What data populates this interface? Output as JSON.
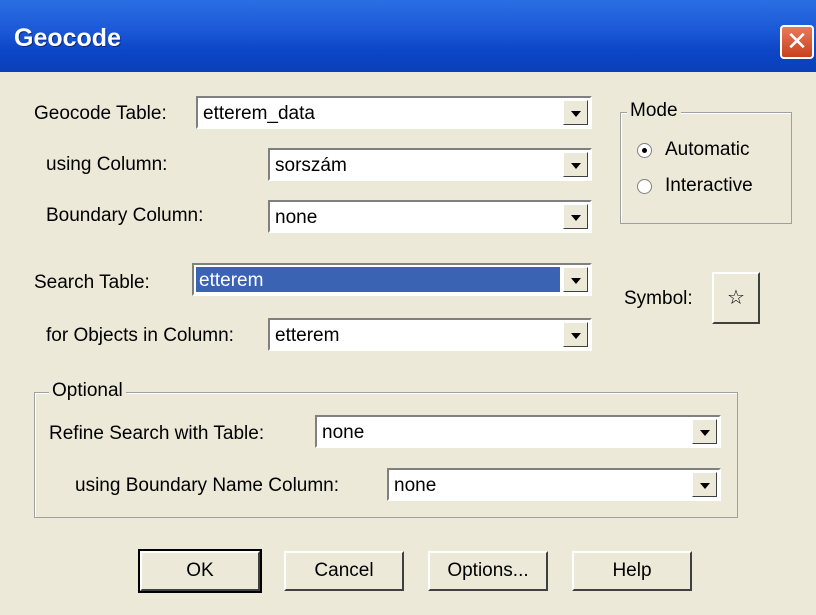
{
  "window": {
    "title": "Geocode",
    "close_glyph": "✕"
  },
  "fields": {
    "geocode_table": {
      "label": "Geocode Table:",
      "value": "etterem_data"
    },
    "using_column": {
      "label": "using Column:",
      "value": "sorszám"
    },
    "boundary_column": {
      "label": "Boundary Column:",
      "value": "none"
    },
    "search_table": {
      "label": "Search Table:",
      "value": "etterem"
    },
    "objects_column": {
      "label": "for Objects in Column:",
      "value": "etterem"
    }
  },
  "mode": {
    "title": "Mode",
    "options": [
      {
        "label": "Automatic",
        "selected": true
      },
      {
        "label": "Interactive",
        "selected": false
      }
    ]
  },
  "symbol": {
    "label": "Symbol:",
    "glyph": "☆"
  },
  "optional": {
    "title": "Optional",
    "refine": {
      "label": "Refine Search with Table:",
      "value": "none"
    },
    "boundary_name": {
      "label": "using Boundary Name Column:",
      "value": "none"
    }
  },
  "buttons": {
    "ok": "OK",
    "cancel": "Cancel",
    "options": "Options...",
    "help": "Help"
  }
}
